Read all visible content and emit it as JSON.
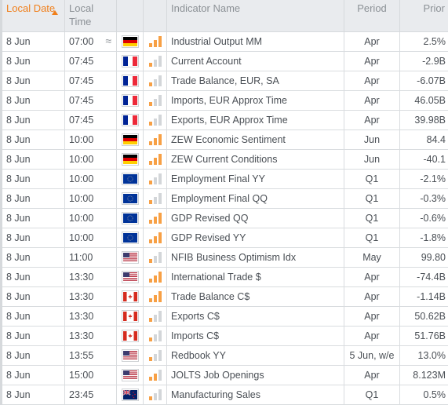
{
  "header": {
    "date": "Local Date",
    "time": "Local Time",
    "flag": "",
    "impact": "",
    "name": "Indicator Name",
    "period": "Period",
    "prior": "Prior",
    "sort_column": "date",
    "sort_direction": "ascending"
  },
  "colors": {
    "accent": "#f07f1b",
    "impact_on": "#f7a045",
    "impact_off": "#d3d6d9",
    "header_bg": "#e9ebee"
  },
  "rows": [
    {
      "date": "8 Jun",
      "time": "07:00",
      "approx_icon": "≈",
      "country": "Germany",
      "flag": "de",
      "impact": 3,
      "name": "Industrial Output MM",
      "period": "Apr",
      "prior": "2.5%"
    },
    {
      "date": "8 Jun",
      "time": "07:45",
      "approx_icon": "",
      "country": "France",
      "flag": "fr",
      "impact": 1,
      "name": "Current Account",
      "period": "Apr",
      "prior": "-2.9B"
    },
    {
      "date": "8 Jun",
      "time": "07:45",
      "approx_icon": "",
      "country": "France",
      "flag": "fr",
      "impact": 1,
      "name": "Trade Balance, EUR, SA",
      "period": "Apr",
      "prior": "-6.07B"
    },
    {
      "date": "8 Jun",
      "time": "07:45",
      "approx_icon": "",
      "country": "France",
      "flag": "fr",
      "impact": 1,
      "name": "Imports, EUR Approx Time",
      "period": "Apr",
      "prior": "46.05B"
    },
    {
      "date": "8 Jun",
      "time": "07:45",
      "approx_icon": "",
      "country": "France",
      "flag": "fr",
      "impact": 1,
      "name": "Exports, EUR Approx Time",
      "period": "Apr",
      "prior": "39.98B"
    },
    {
      "date": "8 Jun",
      "time": "10:00",
      "approx_icon": "",
      "country": "Germany",
      "flag": "de",
      "impact": 3,
      "name": "ZEW Economic Sentiment",
      "period": "Jun",
      "prior": "84.4"
    },
    {
      "date": "8 Jun",
      "time": "10:00",
      "approx_icon": "",
      "country": "Germany",
      "flag": "de",
      "impact": 3,
      "name": "ZEW Current Conditions",
      "period": "Jun",
      "prior": "-40.1"
    },
    {
      "date": "8 Jun",
      "time": "10:00",
      "approx_icon": "",
      "country": "Euro Zone",
      "flag": "eu",
      "impact": 1,
      "name": "Employment Final YY",
      "period": "Q1",
      "prior": "-2.1%"
    },
    {
      "date": "8 Jun",
      "time": "10:00",
      "approx_icon": "",
      "country": "Euro Zone",
      "flag": "eu",
      "impact": 1,
      "name": "Employment Final QQ",
      "period": "Q1",
      "prior": "-0.3%"
    },
    {
      "date": "8 Jun",
      "time": "10:00",
      "approx_icon": "",
      "country": "Euro Zone",
      "flag": "eu",
      "impact": 3,
      "name": "GDP Revised QQ",
      "period": "Q1",
      "prior": "-0.6%"
    },
    {
      "date": "8 Jun",
      "time": "10:00",
      "approx_icon": "",
      "country": "Euro Zone",
      "flag": "eu",
      "impact": 3,
      "name": "GDP Revised YY",
      "period": "Q1",
      "prior": "-1.8%"
    },
    {
      "date": "8 Jun",
      "time": "11:00",
      "approx_icon": "",
      "country": "United States",
      "flag": "us",
      "impact": 1,
      "name": "NFIB Business Optimism Idx",
      "period": "May",
      "prior": "99.80"
    },
    {
      "date": "8 Jun",
      "time": "13:30",
      "approx_icon": "",
      "country": "United States",
      "flag": "us",
      "impact": 3,
      "name": "International Trade $",
      "period": "Apr",
      "prior": "-74.4B"
    },
    {
      "date": "8 Jun",
      "time": "13:30",
      "approx_icon": "",
      "country": "Canada",
      "flag": "ca",
      "impact": 3,
      "name": "Trade Balance C$",
      "period": "Apr",
      "prior": "-1.14B"
    },
    {
      "date": "8 Jun",
      "time": "13:30",
      "approx_icon": "",
      "country": "Canada",
      "flag": "ca",
      "impact": 1,
      "name": "Exports C$",
      "period": "Apr",
      "prior": "50.62B"
    },
    {
      "date": "8 Jun",
      "time": "13:30",
      "approx_icon": "",
      "country": "Canada",
      "flag": "ca",
      "impact": 1,
      "name": "Imports C$",
      "period": "Apr",
      "prior": "51.76B"
    },
    {
      "date": "8 Jun",
      "time": "13:55",
      "approx_icon": "",
      "country": "United States",
      "flag": "us",
      "impact": 1,
      "name": "Redbook YY",
      "period": "5 Jun, w/e",
      "prior": "13.0%"
    },
    {
      "date": "8 Jun",
      "time": "15:00",
      "approx_icon": "",
      "country": "United States",
      "flag": "us",
      "impact": 2,
      "name": "JOLTS Job Openings",
      "period": "Apr",
      "prior": "8.123M"
    },
    {
      "date": "8 Jun",
      "time": "23:45",
      "approx_icon": "",
      "country": "New Zealand",
      "flag": "nz",
      "impact": 1,
      "name": "Manufacturing Sales",
      "period": "Q1",
      "prior": "0.5%"
    }
  ]
}
